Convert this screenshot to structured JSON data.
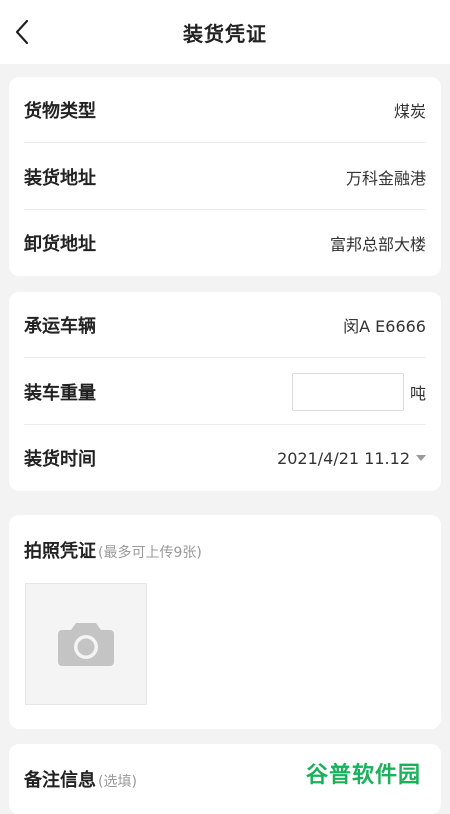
{
  "header": {
    "title": "装货凭证"
  },
  "goods_card": {
    "rows": [
      {
        "label": "货物类型",
        "value": "煤炭"
      },
      {
        "label": "装货地址",
        "value": "万科金融港"
      },
      {
        "label": "卸货地址",
        "value": "富邦总部大楼"
      }
    ]
  },
  "transport_card": {
    "vehicle_label": "承运车辆",
    "vehicle_value": "闵A E6666",
    "weight_label": "装车重量",
    "weight_value": "",
    "weight_unit": "吨",
    "time_label": "装货时间",
    "time_value": "2021/4/21 11.12"
  },
  "photo_card": {
    "title": "拍照凭证",
    "hint": "(最多可上传9张)",
    "upload_icon": "camera-icon"
  },
  "remark_card": {
    "title": "备注信息",
    "hint": "(选填)"
  },
  "watermark": "谷普软件园",
  "colors": {
    "background": "#f3f3f3",
    "card": "#ffffff",
    "watermark": "#19b25c"
  }
}
